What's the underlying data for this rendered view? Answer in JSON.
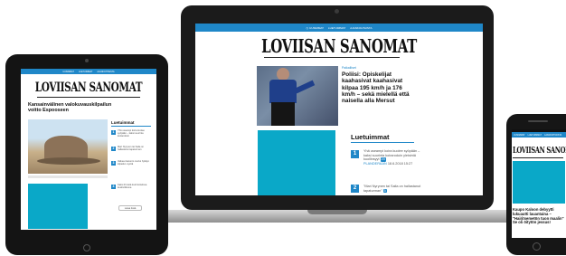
{
  "nav": {
    "items": [
      "UUSIMMAT",
      "LUETUIMMAT",
      "AJANKOHTAISTA"
    ]
  },
  "brand": {
    "logo": "LOVIISAN SANOMAT"
  },
  "laptop": {
    "article": {
      "category": "Paikalliset",
      "headline": "Poliisi: Opiskelijat kaahasivat kaahasivat kilpaa 195 km/h ja 176 km/h – sekä mielellä että naisella alla Mersut"
    },
    "most_read": {
      "title": "Luetuimmat",
      "items": [
        {
          "num": "1",
          "text": "Yhä useampi koira kuolee syöpään – kaksi suurinta koiraroduin yleisintä kuollinsyyt",
          "badge": "20",
          "source": "PLANDERAAN",
          "date": "18.6.2018 15:27"
        },
        {
          "num": "2",
          "text": "\"Mari Nyrynen tai Saila on hallastanut tapaturman\"",
          "badge": "5"
        }
      ]
    }
  },
  "tablet": {
    "headline": "Kansainvälinen valokuvauskilpailun voitto Espooseen",
    "most_read_title": "Luetuimmat",
    "items": [
      {
        "num": "1",
        "text": "Yhä useampi koira kuolee syöpään – kaksi suurinta koiraroduin"
      },
      {
        "num": "2",
        "text": "Mari Nyrynen tai Saila on hallastanut tapaturman"
      },
      {
        "num": "3",
        "text": "Vaikea itsetunto murtui hylätyn kilpailun myötä"
      },
      {
        "num": "4",
        "text": "Kaksi ihmistä kuoli kolarissa keskiviikkona"
      }
    ],
    "more_button": "Lataa lisää"
  },
  "phone": {
    "headline": "Kaupo Kaloon debyytti lukuautti lauantaina – \"Hairitsemetön tuon maalin\" Se oli öitytön jessus!"
  },
  "colors": {
    "nav": "#1f87c8",
    "placeholder": "#0aa8c8",
    "frame": "#1e1e1e"
  }
}
